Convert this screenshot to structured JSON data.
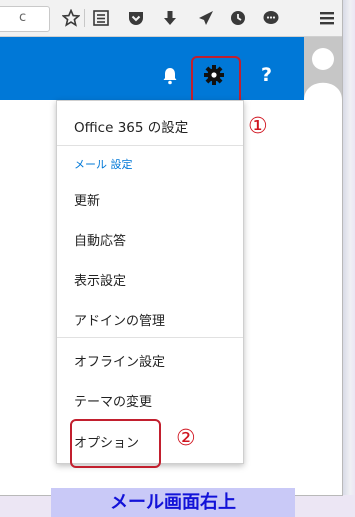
{
  "browser_toolbar": {
    "url_suffix": "c",
    "icons": [
      "reload-icon",
      "star-icon",
      "reading-list-icon",
      "pocket-icon",
      "download-icon",
      "send-icon",
      "history-icon",
      "chat-icon",
      "menu-icon"
    ]
  },
  "header": {
    "icons": [
      "bell-icon",
      "gear-icon",
      "help-icon",
      "avatar-icon"
    ],
    "help_label": "?",
    "accent_color": "#0078d7"
  },
  "annotations": {
    "marker_1": "①",
    "marker_2": "②",
    "highlight_color": "#c21f2e"
  },
  "menu": {
    "office_settings": "Office 365 の設定",
    "mail_settings_label": "メール 設定",
    "items": [
      {
        "label": "更新"
      },
      {
        "label": "自動応答"
      },
      {
        "label": "表示設定"
      },
      {
        "label": "アドインの管理"
      },
      {
        "label": "オフライン設定"
      },
      {
        "label": "テーマの変更"
      },
      {
        "label": "オプション"
      }
    ]
  },
  "caption": "メール画面右上"
}
